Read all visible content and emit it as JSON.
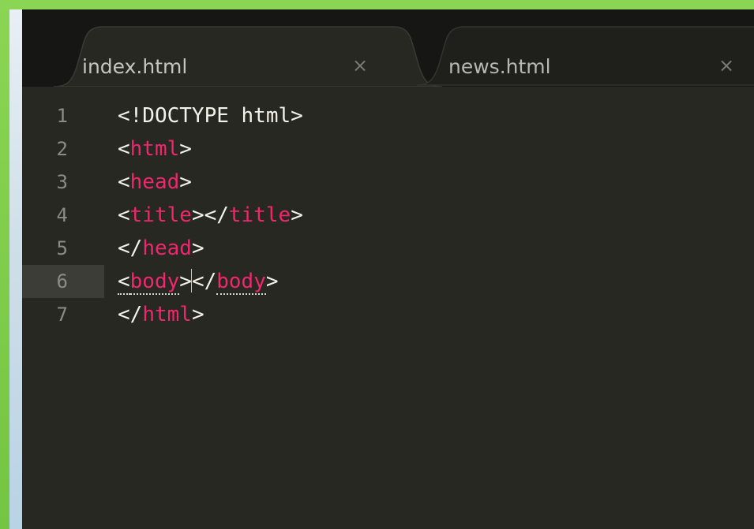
{
  "tabs": [
    {
      "label": "index.html",
      "close": "×",
      "active": true
    },
    {
      "label": "news.html",
      "close": "×",
      "active": false
    }
  ],
  "editor": {
    "current_line": 6,
    "line_numbers": [
      "1",
      "2",
      "3",
      "4",
      "5",
      "6",
      "7"
    ],
    "lines": [
      [
        {
          "t": "<!DOCTYPE html>",
          "c": "plain"
        }
      ],
      [
        {
          "t": "<",
          "c": "punct"
        },
        {
          "t": "html",
          "c": "tag"
        },
        {
          "t": ">",
          "c": "punct"
        }
      ],
      [
        {
          "t": "<",
          "c": "punct"
        },
        {
          "t": "head",
          "c": "tag"
        },
        {
          "t": ">",
          "c": "punct"
        }
      ],
      [
        {
          "t": "<",
          "c": "punct"
        },
        {
          "t": "title",
          "c": "tag"
        },
        {
          "t": "></",
          "c": "punct"
        },
        {
          "t": "title",
          "c": "tag"
        },
        {
          "t": ">",
          "c": "punct"
        }
      ],
      [
        {
          "t": "</",
          "c": "punct"
        },
        {
          "t": "head",
          "c": "tag"
        },
        {
          "t": ">",
          "c": "punct"
        }
      ],
      [
        {
          "t": "<",
          "c": "punct",
          "m": true
        },
        {
          "t": "body",
          "c": "tag",
          "m": true
        },
        {
          "t": ">",
          "c": "punct"
        },
        {
          "caret": true
        },
        {
          "t": "</",
          "c": "punct"
        },
        {
          "t": "body",
          "c": "tag",
          "m": true
        },
        {
          "t": ">",
          "c": "punct"
        }
      ],
      [
        {
          "t": "</",
          "c": "punct"
        },
        {
          "t": "html",
          "c": "tag"
        },
        {
          "t": ">",
          "c": "punct"
        }
      ]
    ]
  },
  "colors": {
    "background": "#272822",
    "tag": "#f0266f",
    "text": "#f2f2ea",
    "line_number": "#8c8c86",
    "tabbar": "#161614",
    "active_tab": "#272822",
    "inactive_tab": "#1f1f1c"
  }
}
